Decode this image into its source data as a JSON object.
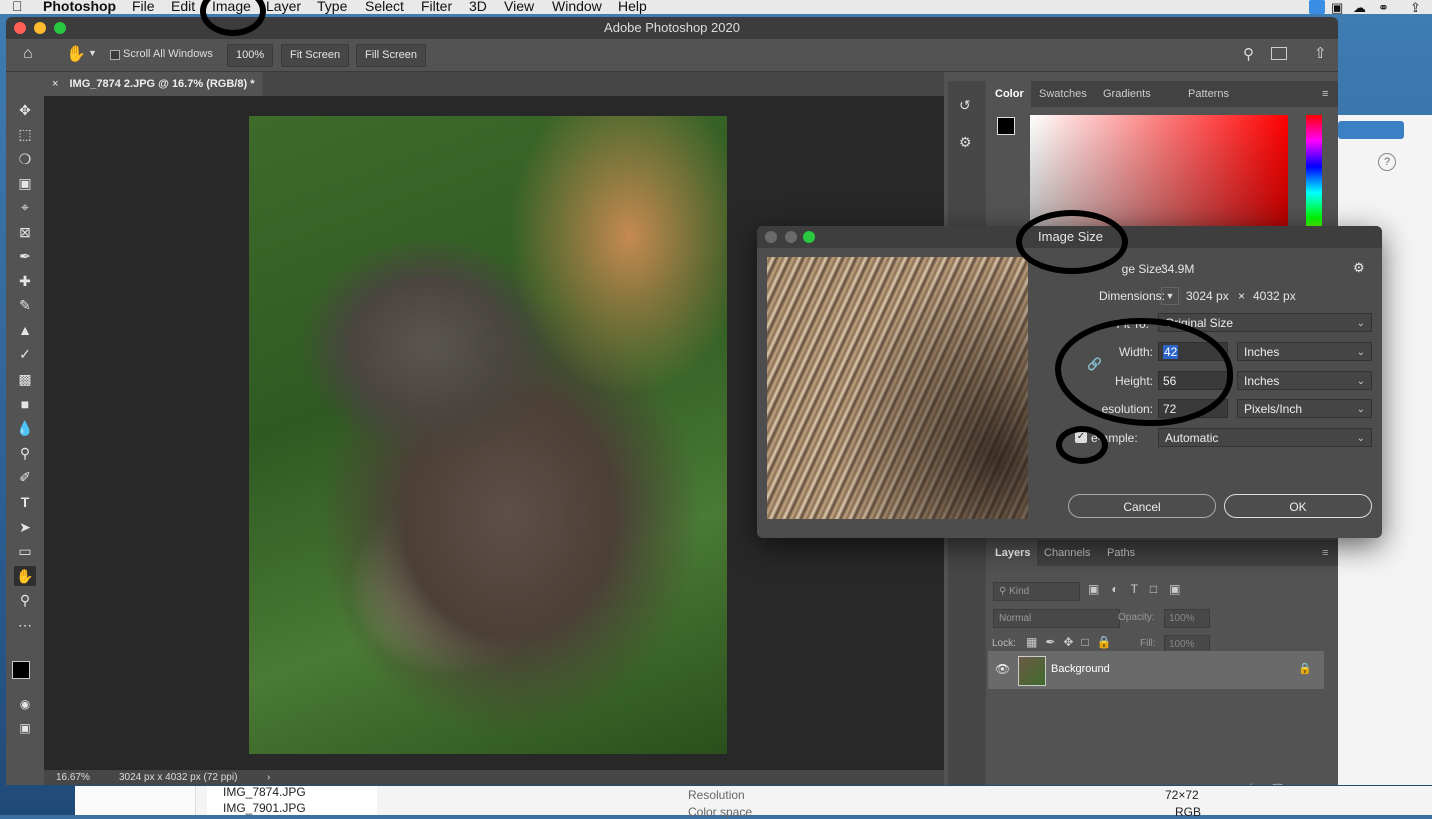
{
  "menubar": {
    "app": "Photoshop",
    "items": [
      "File",
      "Edit",
      "Image",
      "Layer",
      "Type",
      "Select",
      "Filter",
      "3D",
      "View",
      "Window",
      "Help"
    ]
  },
  "window": {
    "title": "Adobe Photoshop 2020"
  },
  "options": {
    "scroll_all": "Scroll All Windows",
    "zoom_btn": "100%",
    "fit_screen": "Fit Screen",
    "fill_screen": "Fill Screen"
  },
  "document": {
    "tab": "IMG_7874 2.JPG @ 16.7% (RGB/8) *"
  },
  "status": {
    "zoom": "16.67%",
    "info": "3024 px x 4032 px (72 ppi)"
  },
  "color_panel": {
    "tabs": [
      "Color",
      "Swatches",
      "Gradients",
      "Patterns"
    ]
  },
  "layers_panel": {
    "tabs": [
      "Layers",
      "Channels",
      "Paths"
    ],
    "kind": "Kind",
    "blend": "Normal",
    "opacity_label": "Opacity:",
    "opacity": "100%",
    "lock_label": "Lock:",
    "fill_label": "Fill:",
    "fill": "100%",
    "layer_name": "Background"
  },
  "dialog": {
    "title": "Image Size",
    "image_size_label": "ge Size:",
    "image_size_value": "34.9M",
    "dimensions_label": "Dimensions:",
    "dim_w": "3024 px",
    "dim_x": "×",
    "dim_h": "4032 px",
    "fit_to_label": "Fit To:",
    "fit_to": "Original Size",
    "width_label": "Width:",
    "width": "42",
    "width_unit": "Inches",
    "height_label": "Height:",
    "height": "56",
    "height_unit": "Inches",
    "resolution_label": "esolution:",
    "resolution": "72",
    "resolution_unit": "Pixels/Inch",
    "resample_label": "e-ample:",
    "resample": "Automatic",
    "cancel": "Cancel",
    "ok": "OK"
  },
  "finder": {
    "files": [
      "IMG_7874.JPG",
      "IMG_7901.JPG"
    ],
    "resolution_label": "Resolution",
    "resolution_value": "72×72",
    "colorspace_label": "Color space",
    "colorspace_value": "RGB"
  }
}
